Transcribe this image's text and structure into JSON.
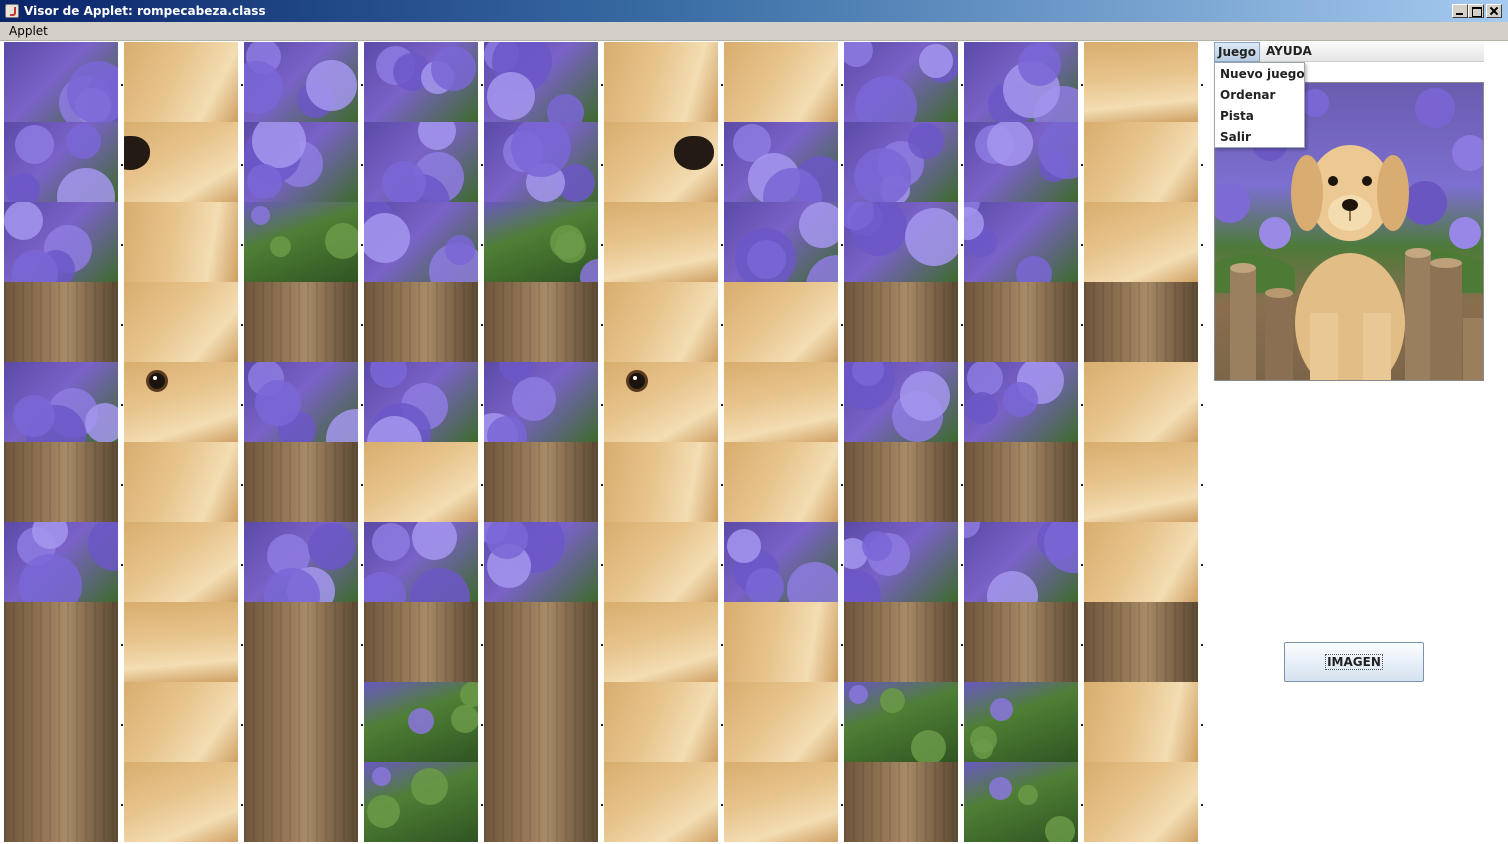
{
  "window": {
    "title": "Visor de Applet: rompecabeza.class"
  },
  "menubar": {
    "applet_label": "Applet"
  },
  "game_menu": {
    "juego_label": "Juego",
    "ayuda_label": "AYUDA",
    "items": [
      "Nuevo juego",
      "Ordenar",
      "Pista",
      "Salir"
    ]
  },
  "button": {
    "imagen_label": "IMAGEN"
  },
  "puzzle": {
    "columns": 10,
    "rows": 10,
    "tiles": [
      [
        "purple",
        "dog",
        "purple",
        "purple",
        "purple",
        "dog",
        "dog",
        "purple",
        "purple",
        "dog"
      ],
      [
        "purple",
        "dog-nose",
        "purple",
        "purple",
        "purple",
        "dog-nose",
        "purple",
        "purple",
        "purple",
        "dog"
      ],
      [
        "purple",
        "dog",
        "green",
        "purple",
        "green",
        "dog",
        "purple",
        "purple",
        "purple",
        "dog"
      ],
      [
        "wood",
        "dog",
        "wood",
        "wood",
        "wood",
        "dog",
        "dog",
        "wood",
        "wood",
        "wood"
      ],
      [
        "purple",
        "dog-eye",
        "purple",
        "purple",
        "purple",
        "dog-eye",
        "dog",
        "purple",
        "purple",
        "dog"
      ],
      [
        "wood",
        "dog",
        "wood",
        "dog",
        "wood",
        "dog",
        "dog",
        "wood",
        "wood",
        "dog"
      ],
      [
        "purple",
        "dog",
        "purple",
        "purple",
        "purple",
        "dog",
        "purple",
        "purple",
        "purple",
        "dog"
      ],
      [
        "wood",
        "dog",
        "wood",
        "wood",
        "wood",
        "dog",
        "dog",
        "wood",
        "wood",
        "wood"
      ],
      [
        "wood",
        "dog",
        "wood",
        "green",
        "wood",
        "dog",
        "dog",
        "green",
        "green",
        "dog"
      ],
      [
        "wood",
        "dog",
        "wood",
        "green",
        "wood",
        "dog",
        "dog",
        "wood",
        "green",
        "dog"
      ]
    ]
  },
  "colors": {
    "purple": "#7a62c8",
    "green": "#4f7f35",
    "wood": "#8c7050",
    "dog": "#e8c58e"
  }
}
